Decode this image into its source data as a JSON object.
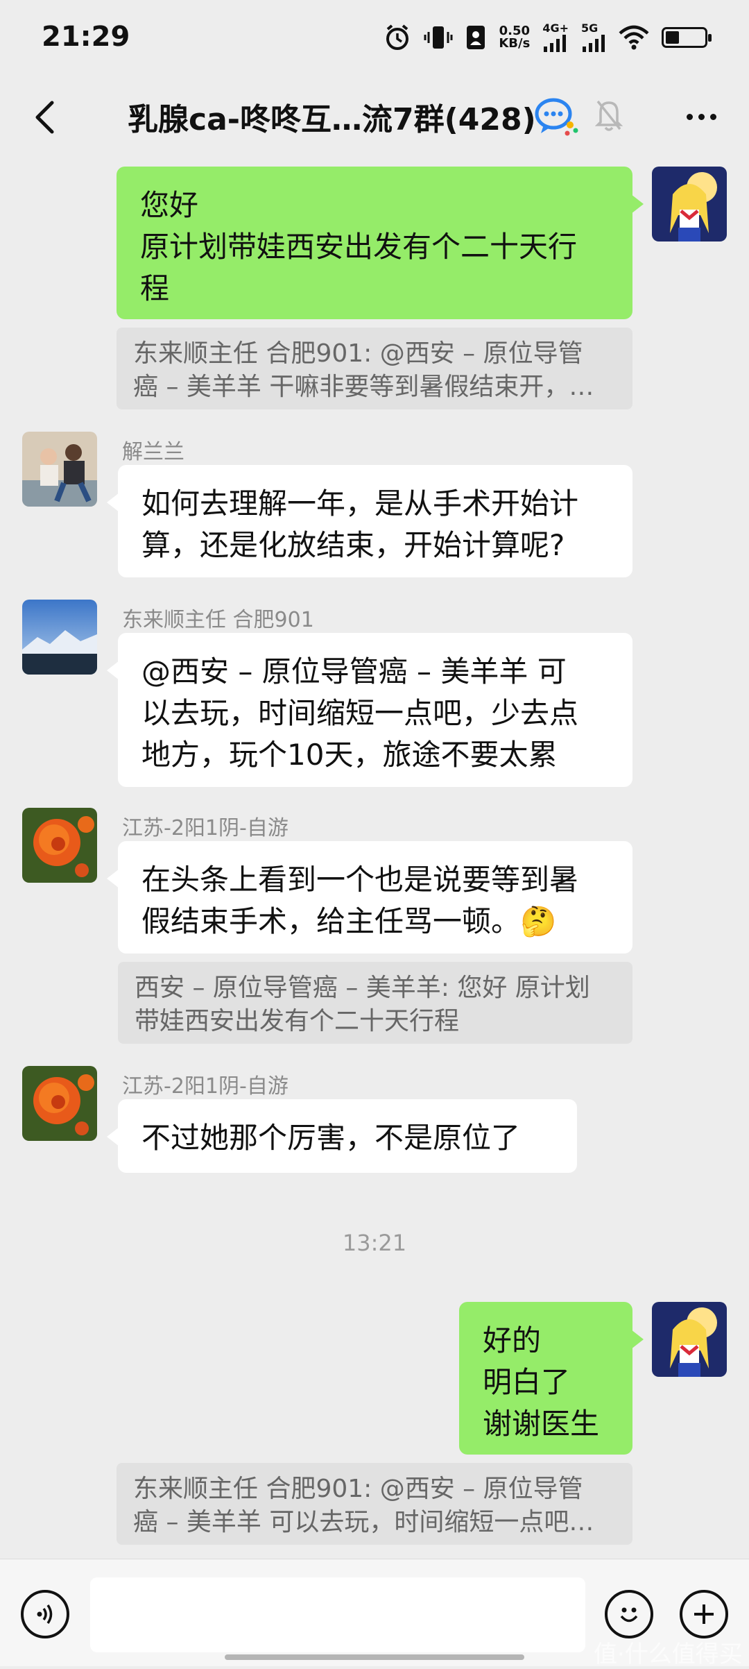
{
  "status_bar": {
    "time": "21:29",
    "net_speed_value": "0.50",
    "net_speed_unit": "KB/s",
    "signal1_label": "4G+",
    "signal2_label": "5G",
    "battery_level": 0.35
  },
  "header": {
    "title": "乳腺ca-咚咚互…流7群(428)"
  },
  "messages": [
    {
      "type": "sent",
      "text_lines": [
        "您好",
        "原计划带娃西安出发有个二十天行",
        "程"
      ]
    },
    {
      "type": "quote",
      "text_lines": [
        "东来顺主任 合肥901: @西安 – 原位导管",
        "癌 – 美羊羊 干嘛非要等到暑假结束开，…"
      ]
    },
    {
      "type": "received",
      "sender": "解兰兰",
      "text_lines": [
        "如何去理解一年，是从手术开始计",
        "算，还是化放结束，开始计算呢?"
      ]
    },
    {
      "type": "received",
      "sender": "东来顺主任 合肥901",
      "text_lines": [
        "@西安 – 原位导管癌 – 美羊羊  可",
        "以去玩，时间缩短一点吧，少去点",
        "地方，玩个10天，旅途不要太累"
      ]
    },
    {
      "type": "received",
      "sender": "江苏-2阳1阴-自游",
      "text_lines": [
        "在头条上看到一个也是说要等到暑",
        "假结束手术，给主任骂一顿。🤔"
      ]
    },
    {
      "type": "quote",
      "text_lines": [
        "西安 – 原位导管癌 – 美羊羊: 您好 原计划",
        "带娃西安出发有个二十天行程"
      ]
    },
    {
      "type": "received",
      "sender": "江苏-2阳1阴-自游",
      "text_lines": [
        "不过她那个厉害，不是原位了"
      ]
    },
    {
      "type": "time",
      "text": "13:21"
    },
    {
      "type": "sent",
      "text_lines": [
        "好的",
        "明白了",
        "谢谢医生"
      ]
    },
    {
      "type": "quote",
      "text_lines": [
        "东来顺主任 合肥901: @西安 – 原位导管",
        "癌 – 美羊羊 可以去玩，时间缩短一点吧…"
      ]
    }
  ],
  "input_bar": {
    "voice_icon": "voice-icon",
    "emoji_icon": "emoji-icon",
    "plus_icon": "plus-icon"
  },
  "watermark": "值·什么值得买"
}
